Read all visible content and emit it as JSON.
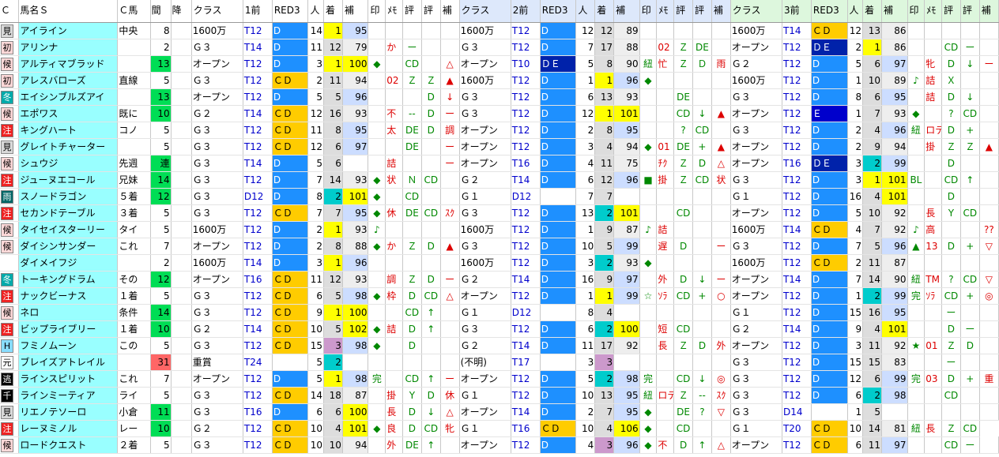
{
  "headers": [
    "Ｃ",
    "馬名Ｓ",
    "Ｃ馬",
    "間",
    "降",
    "クラス",
    "1前",
    "RED3",
    "人",
    "着",
    "補",
    "印",
    "ﾒﾓ",
    "評",
    "評",
    "補",
    "クラス",
    "2前",
    "RED3",
    "人",
    "着",
    "補",
    "印",
    "ﾒﾓ",
    "評",
    "評",
    "補",
    "クラス",
    "3前",
    "RED3",
    "人",
    "着",
    "補",
    "印",
    "ﾒﾓ",
    "評",
    "評",
    "補"
  ],
  "rows": [
    [
      "見",
      "アイライン",
      "中央",
      "8",
      "",
      "1600万",
      "T12",
      "D",
      "14",
      "1",
      "95",
      "",
      "",
      "",
      "",
      "",
      "1600万",
      "T12",
      "D",
      "12",
      "12",
      "89",
      "",
      "",
      "",
      "",
      "",
      "1600万",
      "T14",
      "ＣＤ",
      "12",
      "13",
      "86",
      "",
      "",
      "",
      "",
      ""
    ],
    [
      "初",
      "アリンナ",
      "",
      "2",
      "",
      "Ｇ３",
      "T14",
      "D",
      "11",
      "12",
      "79",
      "",
      "か",
      "ー",
      "",
      "",
      "Ｇ３",
      "T12",
      "D",
      "7",
      "17",
      "88",
      "",
      "02",
      "Ｚ",
      "DE",
      "",
      "オープン",
      "T12",
      "ＤＥ",
      "2",
      "1",
      "86",
      "",
      "",
      "CD",
      "ー",
      ""
    ],
    [
      "候",
      "アルティマブラッド",
      "",
      "13",
      "",
      "オープン",
      "T12",
      "D",
      "3",
      "1",
      "100",
      "◆",
      "",
      "CD",
      "",
      "△",
      "オープン",
      "T10",
      "ＤＥ",
      "5",
      "8",
      "90",
      "紐",
      "忙",
      "Ｚ",
      "Ｄ",
      "雨",
      "Ｇ２",
      "T12",
      "D",
      "5",
      "6",
      "97",
      "",
      "牝",
      "D",
      "↓",
      "ー"
    ],
    [
      "初",
      "アレスバローズ",
      "直線",
      "5",
      "",
      "Ｇ３",
      "T12",
      "ＣＤ",
      "2",
      "11",
      "94",
      "",
      "02",
      "Ｚ",
      "Ｚ",
      "▲",
      "1600万",
      "T12",
      "D",
      "1",
      "1",
      "96",
      "◆",
      "",
      "",
      "",
      "",
      "1600万",
      "T12",
      "D",
      "1",
      "10",
      "89",
      "♪",
      "詰",
      "Ｘ",
      "",
      ""
    ],
    [
      "冬",
      "エイシンブルズアイ",
      "",
      "13",
      "",
      "オープン",
      "T12",
      "D",
      "5",
      "5",
      "96",
      "",
      "",
      "",
      "D",
      "↓",
      "Ｇ３",
      "T12",
      "D",
      "6",
      "13",
      "93",
      "",
      "",
      "DE",
      "",
      "",
      "Ｇ３",
      "T12",
      "D",
      "8",
      "6",
      "95",
      "",
      "詰",
      "D",
      "↓",
      ""
    ],
    [
      "候",
      "エポワス",
      "既に",
      "10",
      "",
      "Ｇ２",
      "T14",
      "ＣＤ",
      "12",
      "16",
      "93",
      "",
      "不",
      "--",
      "D",
      "ー",
      "Ｇ３",
      "T12",
      "D",
      "12",
      "1",
      "101",
      "",
      "",
      "CD",
      "↓",
      "▲",
      "オープン",
      "T12",
      "Ｅ",
      "1",
      "7",
      "93",
      "◆",
      "",
      "?",
      "CD",
      ""
    ],
    [
      "注",
      "キングハート",
      "コノ",
      "5",
      "",
      "Ｇ３",
      "T12",
      "ＣＤ",
      "11",
      "8",
      "95",
      "",
      "太",
      "DE",
      "D",
      "調",
      "オープン",
      "T12",
      "D",
      "2",
      "8",
      "95",
      "",
      "",
      "?",
      "CD",
      "",
      "Ｇ３",
      "T12",
      "D",
      "2",
      "4",
      "96",
      "紐",
      "ロテ",
      "D",
      "+",
      ""
    ],
    [
      "見",
      "グレイトチャーター",
      "",
      "5",
      "",
      "Ｇ３",
      "T12",
      "ＣＤ",
      "12",
      "6",
      "97",
      "",
      "",
      "DE",
      "",
      "ー",
      "オープン",
      "T12",
      "D",
      "3",
      "4",
      "94",
      "◆",
      "01",
      "DE",
      "+",
      "▲",
      "オープン",
      "T12",
      "D",
      "2",
      "9",
      "94",
      "",
      "掛",
      "Ｚ",
      "Ｚ",
      "▲"
    ],
    [
      "候",
      "シュウジ",
      "先週",
      "連",
      "",
      "Ｇ３",
      "T14",
      "D",
      "5",
      "6",
      "",
      "",
      "詰",
      "",
      "",
      "ー",
      "オープン",
      "T16",
      "D",
      "4",
      "11",
      "75",
      "",
      "ﾁｸ",
      "Ｚ",
      "D",
      "△",
      "オープン",
      "T16",
      "ＤＥ",
      "3",
      "2",
      "99",
      "",
      "",
      "D",
      "",
      ""
    ],
    [
      "注",
      "ジューヌエコール",
      "兄妹",
      "14",
      "",
      "Ｇ３",
      "T12",
      "D",
      "7",
      "14",
      "93",
      "◆",
      "状",
      "Ｎ",
      "CD",
      "",
      "Ｇ２",
      "T14",
      "D",
      "6",
      "12",
      "96",
      "■",
      "掛",
      "Ｚ",
      "CD",
      "状",
      "Ｇ３",
      "T12",
      "D",
      "3",
      "1",
      "101",
      "BL",
      "",
      "CD",
      "↑",
      ""
    ],
    [
      "雨",
      "スノードラゴン",
      "５着",
      "12",
      "",
      "Ｇ３",
      "D12",
      "D",
      "8",
      "2",
      "101",
      "◆",
      "",
      "CD",
      "",
      "",
      "Ｇ１",
      "D12",
      "",
      "7",
      "7",
      "",
      "",
      "",
      "",
      "",
      "",
      "Ｇ１",
      "T12",
      "D",
      "16",
      "4",
      "101",
      "",
      "",
      "D",
      "",
      ""
    ],
    [
      "注",
      "セカンドテーブル",
      "３着",
      "5",
      "",
      "Ｇ３",
      "T12",
      "ＣＤ",
      "7",
      "7",
      "95",
      "◆",
      "休",
      "DE",
      "CD",
      "ｽｸ",
      "Ｇ３",
      "T12",
      "D",
      "13",
      "2",
      "101",
      "",
      "",
      "CD",
      "",
      "",
      "オープン",
      "T12",
      "D",
      "5",
      "10",
      "92",
      "",
      "長",
      "Y",
      "CD",
      ""
    ],
    [
      "候",
      "タイセイスターリー",
      "タイ",
      "5",
      "",
      "1600万",
      "T12",
      "D",
      "2",
      "1",
      "93",
      "♪",
      "",
      "",
      "",
      "",
      "1600万",
      "T12",
      "D",
      "1",
      "9",
      "87",
      "♪",
      "詰",
      "",
      "",
      "",
      "1600万",
      "T14",
      "ＣＤ",
      "4",
      "7",
      "92",
      "♪",
      "高",
      "",
      "",
      "??"
    ],
    [
      "候",
      "ダイシンサンダー",
      "これ",
      "7",
      "",
      "オープン",
      "T12",
      "D",
      "2",
      "8",
      "88",
      "◆",
      "か",
      "Ｚ",
      "D",
      "▲",
      "Ｇ３",
      "T12",
      "D",
      "10",
      "5",
      "99",
      "",
      "遅",
      "D",
      "",
      "ー",
      "Ｇ３",
      "T12",
      "D",
      "7",
      "5",
      "96",
      "▲",
      "13",
      "D",
      "+",
      "▽"
    ],
    [
      "",
      "ダイメイフジ",
      "",
      "2",
      "",
      "1600万",
      "T14",
      "D",
      "3",
      "1",
      "96",
      "",
      "",
      "",
      "",
      "",
      "1600万",
      "T12",
      "D",
      "3",
      "2",
      "93",
      "◆",
      "",
      "",
      "",
      "",
      "1600万",
      "T12",
      "ＣＤ",
      "2",
      "11",
      "87",
      "",
      "",
      "",
      "",
      ""
    ],
    [
      "冬",
      "トーキングドラム",
      "その",
      "12",
      "",
      "オープン",
      "T16",
      "ＣＤ",
      "11",
      "12",
      "93",
      "",
      "調",
      "Ｚ",
      "D",
      "ー",
      "Ｇ２",
      "T14",
      "D",
      "16",
      "9",
      "97",
      "",
      "外",
      "D",
      "↓",
      "ー",
      "オープン",
      "T14",
      "D",
      "7",
      "14",
      "90",
      "紐",
      "TM",
      "?",
      "CD",
      "▽"
    ],
    [
      "注",
      "ナックビーナス",
      "１着",
      "5",
      "",
      "Ｇ３",
      "T12",
      "ＣＤ",
      "6",
      "5",
      "98",
      "◆",
      "枠",
      "D",
      "CD",
      "△",
      "オープン",
      "T12",
      "D",
      "1",
      "1",
      "99",
      "☆",
      "ｿﾗ",
      "CD",
      "+",
      "○",
      "オープン",
      "T12",
      "D",
      "1",
      "2",
      "99",
      "完",
      "ｿﾗ",
      "CD",
      "+",
      "◎"
    ],
    [
      "候",
      "ネロ",
      "条件",
      "14",
      "",
      "Ｇ３",
      "T12",
      "ＣＤ",
      "9",
      "1",
      "100",
      "",
      "",
      "CD",
      "↑",
      "",
      "Ｇ１",
      "D12",
      "",
      "8",
      "4",
      "",
      "",
      "",
      "",
      "",
      "",
      "Ｇ１",
      "T12",
      "D",
      "15",
      "16",
      "95",
      "",
      "",
      "ー",
      "",
      ""
    ],
    [
      "注",
      "ビップライブリー",
      "１着",
      "10",
      "",
      "Ｇ２",
      "T14",
      "ＣＤ",
      "10",
      "5",
      "102",
      "◆",
      "詰",
      "D",
      "↑",
      "",
      "Ｇ３",
      "T12",
      "D",
      "6",
      "2",
      "100",
      "",
      "短",
      "CD",
      "",
      "",
      "Ｇ２",
      "T14",
      "D",
      "9",
      "4",
      "101",
      "",
      "",
      "D",
      "ー",
      ""
    ],
    [
      "H",
      "フミノムーン",
      "この",
      "5",
      "",
      "Ｇ３",
      "T12",
      "ＣＤ",
      "15",
      "3",
      "98",
      "◆",
      "",
      "D",
      "",
      "",
      "Ｇ２",
      "T14",
      "D",
      "11",
      "17",
      "92",
      "",
      "長",
      "Ｚ",
      "D",
      "外",
      "オープン",
      "T12",
      "D",
      "3",
      "11",
      "92",
      "★",
      "01",
      "Ｚ",
      "D",
      ""
    ],
    [
      "元",
      "ブレイズアトレイル",
      "",
      "31",
      "",
      "重賞",
      "T24",
      "",
      "5",
      "2",
      "",
      "",
      "",
      "",
      "",
      "",
      "(不明)",
      "T17",
      "",
      "3",
      "3",
      "",
      "",
      "",
      "",
      "",
      "",
      "Ｇ３",
      "T12",
      "D",
      "15",
      "15",
      "83",
      "",
      "",
      "ー",
      "",
      ""
    ],
    [
      "逃",
      "ラインスピリット",
      "これ",
      "7",
      "",
      "オープン",
      "T12",
      "D",
      "5",
      "1",
      "98",
      "完",
      "",
      "CD",
      "↑",
      "ー",
      "オープン",
      "T12",
      "D",
      "5",
      "2",
      "98",
      "完",
      "",
      "CD",
      "↓",
      "◎",
      "Ｇ３",
      "T12",
      "D",
      "12",
      "6",
      "99",
      "完",
      "03",
      "D",
      "+",
      "重"
    ],
    [
      "千",
      "ラインミーティア",
      "ライ",
      "5",
      "",
      "Ｇ３",
      "T12",
      "ＣＤ",
      "14",
      "18",
      "87",
      "",
      "掛",
      "Y",
      "D",
      "休",
      "Ｇ１",
      "T12",
      "D",
      "10",
      "13",
      "95",
      "紐",
      "ロテ",
      "Ｚ",
      "--",
      "ｽｸ",
      "Ｇ３",
      "T12",
      "D",
      "6",
      "2",
      "98",
      "",
      "",
      "CD",
      "",
      ""
    ],
    [
      "見",
      "リエノテソーロ",
      "小倉",
      "11",
      "",
      "Ｇ３",
      "T16",
      "D",
      "6",
      "6",
      "100",
      "",
      "長",
      "D",
      "↓",
      "△",
      "オープン",
      "T14",
      "D",
      "2",
      "7",
      "95",
      "◆",
      "",
      "DE",
      "?",
      "▽",
      "Ｇ３",
      "D14",
      "",
      "1",
      "5",
      "",
      "",
      "",
      "",
      "",
      ""
    ],
    [
      "注",
      "レーヌミノル",
      "レー",
      "10",
      "",
      "Ｇ２",
      "T12",
      "ＣＤ",
      "10",
      "4",
      "101",
      "◆",
      "良",
      "D",
      "CD",
      "牝",
      "Ｇ１",
      "T16",
      "ＣＤ",
      "10",
      "4",
      "106",
      "◆",
      "",
      "CD",
      "",
      "",
      "Ｇ１",
      "T20",
      "ＣＤ",
      "10",
      "14",
      "81",
      "紐",
      "長",
      "Ｚ",
      "CD"
    ],
    [
      "候",
      "ロードクエスト",
      "２着",
      "5",
      "",
      "Ｇ３",
      "T12",
      "ＣＤ",
      "10",
      "10",
      "94",
      "",
      "外",
      "DE",
      "↑",
      "",
      "オープン",
      "T12",
      "D",
      "4",
      "3",
      "96",
      "◆",
      "不",
      "D",
      "↑",
      "△",
      "オープン",
      "T12",
      "ＣＤ",
      "6",
      "11",
      "97",
      "",
      "",
      "CD",
      "ー",
      ""
    ]
  ],
  "colors": {
    "accent_red": "#ff6666",
    "accent_green": "#00dd55",
    "d_blue": "#1e90ff",
    "cd_yellow": "#ffcc00"
  }
}
